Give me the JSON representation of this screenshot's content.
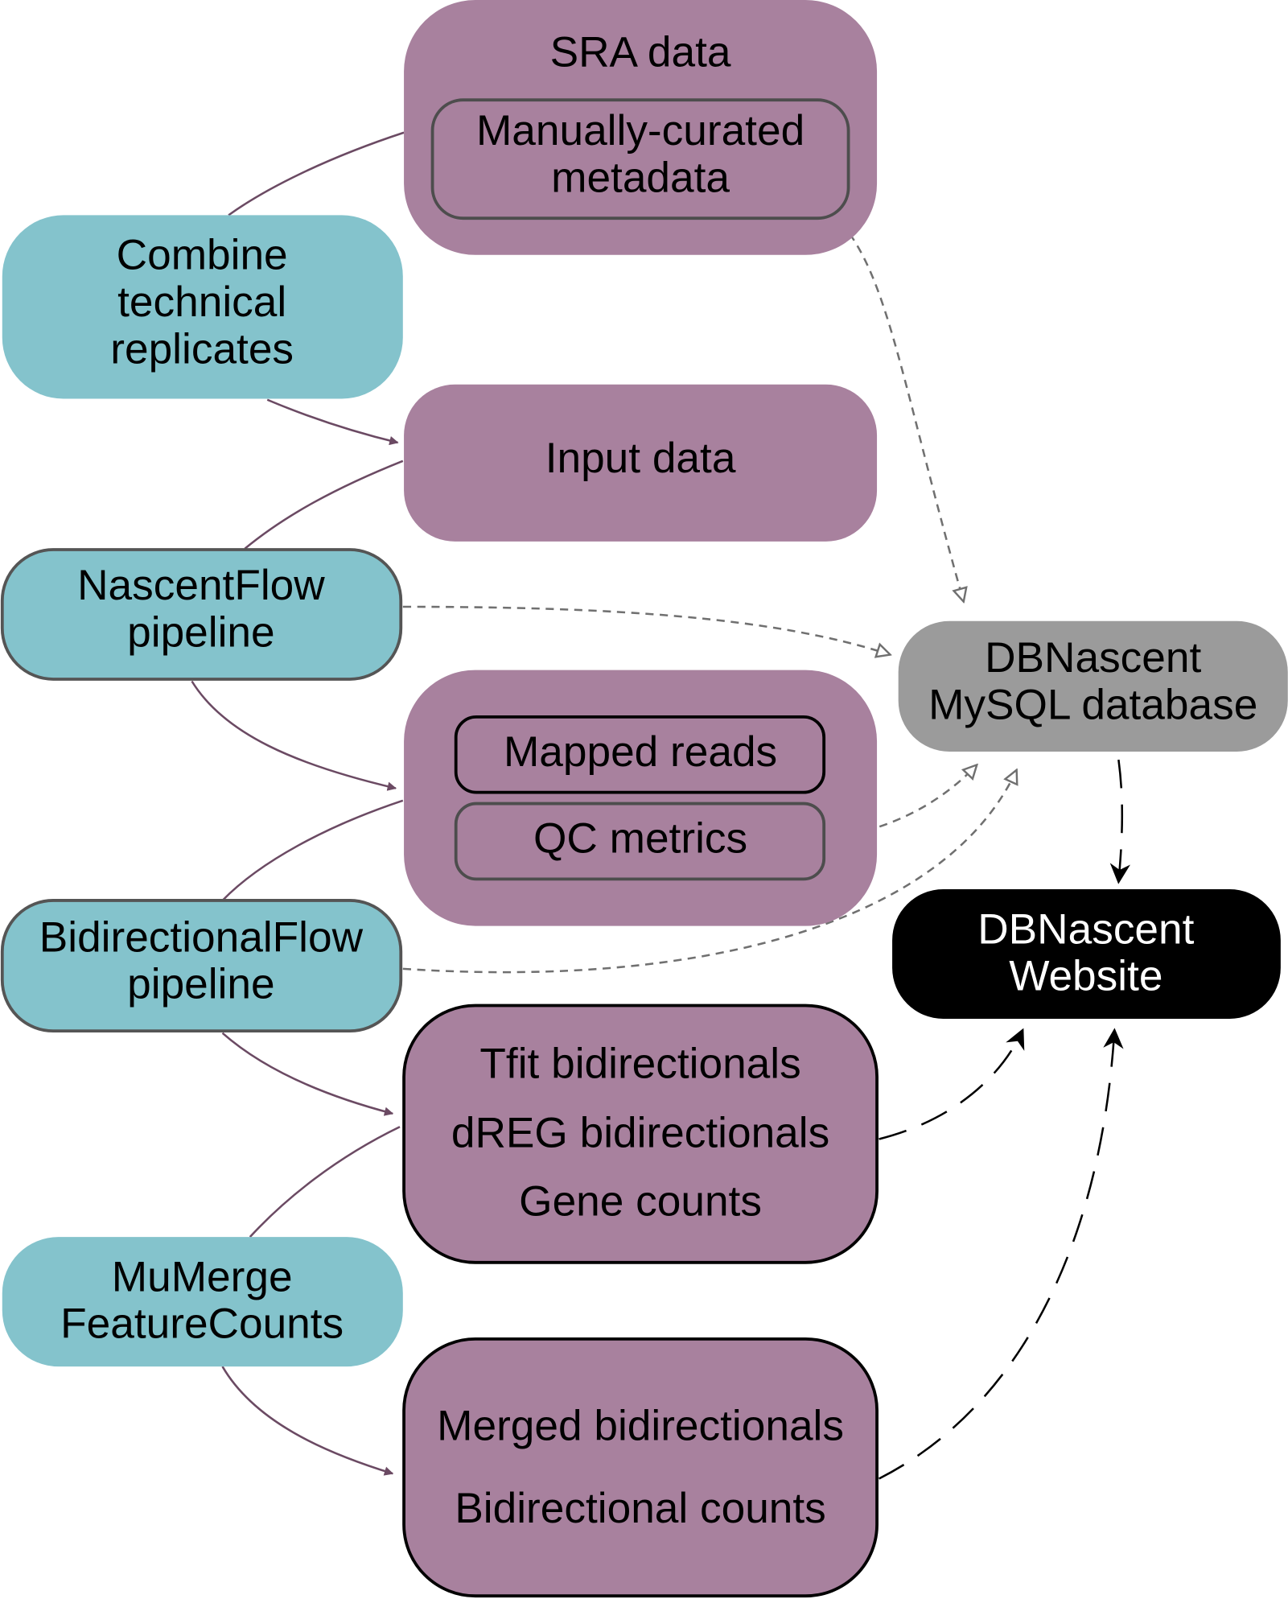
{
  "colors": {
    "data_box": "#a8819e",
    "process_box": "#84c3cc",
    "database": "#9b9b9b",
    "website": "#000000",
    "solid_arrow": "#6b4a63",
    "dashed_gray": "#707070"
  },
  "nodes": {
    "sra": {
      "title": "SRA data",
      "inner": [
        "Manually-curated",
        "metadata"
      ]
    },
    "combine": {
      "lines": [
        "Combine",
        "technical",
        "replicates"
      ]
    },
    "input": {
      "label": "Input data"
    },
    "nascentflow": {
      "lines": [
        "NascentFlow",
        "pipeline"
      ]
    },
    "mapped": {
      "reads": "Mapped reads",
      "qc": "QC metrics"
    },
    "bidirectionalflow": {
      "lines": [
        "BidirectionalFlow",
        "pipeline"
      ]
    },
    "tfit": {
      "lines": [
        "Tfit bidirectionals",
        "dREG bidirectionals",
        "Gene counts"
      ]
    },
    "mumerge": {
      "lines": [
        "MuMerge",
        "FeatureCounts"
      ]
    },
    "merged": {
      "lines": [
        "Merged bidirectionals",
        "Bidirectional counts"
      ]
    },
    "database": {
      "lines": [
        "DBNascent",
        "MySQL database"
      ]
    },
    "website": {
      "lines": [
        "DBNascent",
        "Website"
      ]
    }
  }
}
